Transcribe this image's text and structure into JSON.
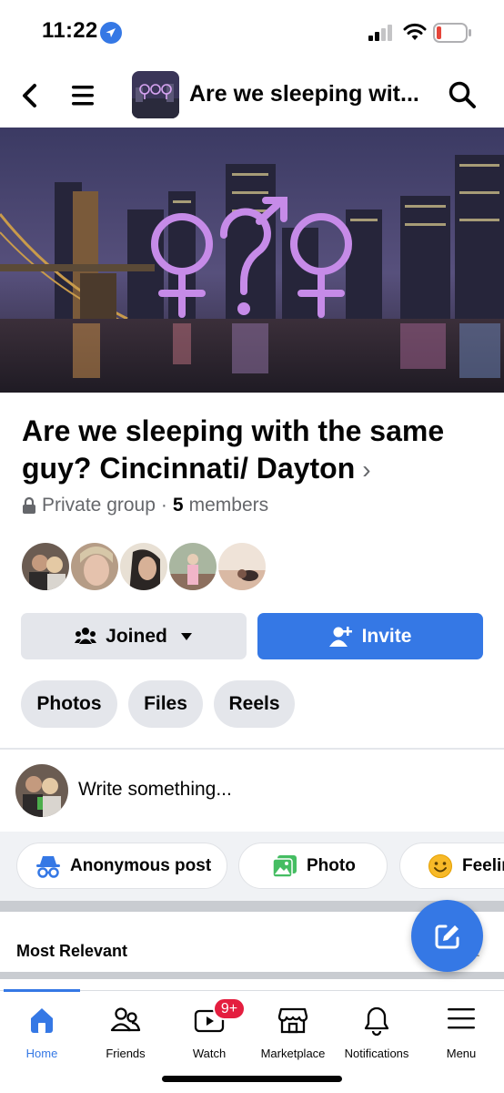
{
  "status_bar": {
    "time": "11:22",
    "location_icon": "location-arrow-icon",
    "signal_icon": "cellular-signal-icon",
    "wifi_icon": "wifi-icon",
    "battery_icon": "battery-low-icon",
    "battery_color": "#e5453a"
  },
  "header": {
    "back_icon": "chevron-left-icon",
    "menu_icon": "hamburger-icon",
    "title": "Are we sleeping wit...",
    "search_icon": "search-icon"
  },
  "group": {
    "name": "Are we sleeping with the same guy? Cincinnati/ Dayton",
    "name_chevron": "›",
    "privacy": "Private group",
    "separator": "·",
    "member_count": "5",
    "members_label": "members"
  },
  "buttons": {
    "joined": "Joined",
    "invite": "Invite"
  },
  "chips": [
    "Photos",
    "Files",
    "Reels"
  ],
  "composer": {
    "placeholder": "Write something..."
  },
  "post_actions": [
    {
      "label": "Anonymous post",
      "icon": "incognito-icon"
    },
    {
      "label": "Photo",
      "icon": "photo-icon"
    },
    {
      "label": "Feelin",
      "icon": "smiley-icon"
    }
  ],
  "feed": {
    "sort_label": "Most Relevant",
    "sort_fragment": "t"
  },
  "tabbar": {
    "items": [
      {
        "label": "Home",
        "icon": "home-icon",
        "active": true
      },
      {
        "label": "Friends",
        "icon": "friends-icon"
      },
      {
        "label": "Watch",
        "icon": "watch-icon",
        "badge": "9+"
      },
      {
        "label": "Marketplace",
        "icon": "marketplace-icon"
      },
      {
        "label": "Notifications",
        "icon": "bell-icon"
      },
      {
        "label": "Menu",
        "icon": "menu-icon"
      }
    ]
  },
  "colors": {
    "accent": "#3578e5",
    "badge": "#e41e3f",
    "chip_bg": "#e4e6eb",
    "cover_symbols": "#c68be8"
  }
}
